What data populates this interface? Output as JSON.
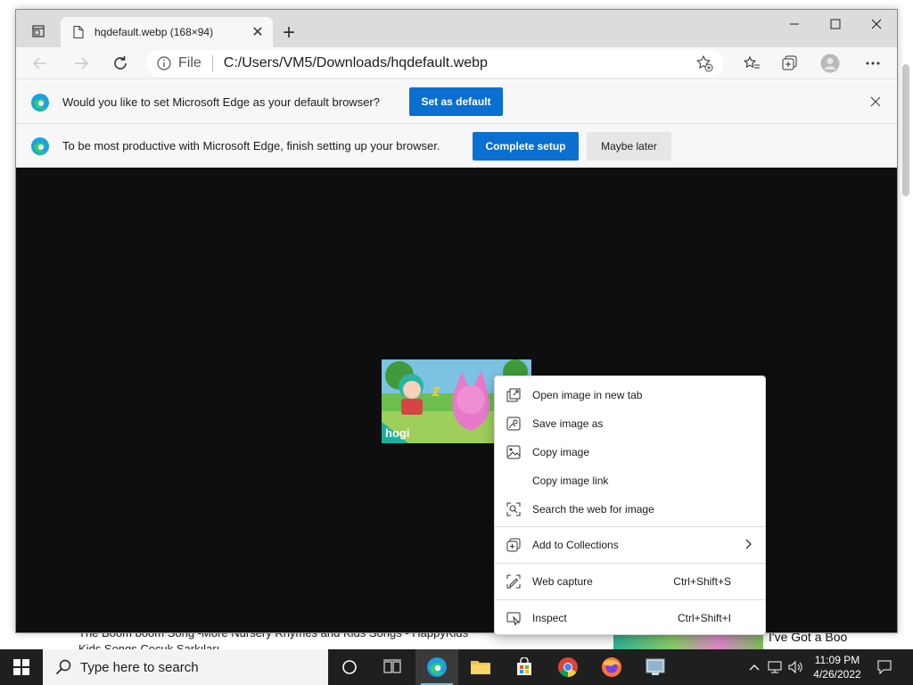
{
  "desktop": {
    "behind_text_1": "The Boom boom Song -More Nursery Rhymes and Kids Songs - HappyKids  ",
    "behind_text_2": "Kids Songs Çocuk Şarkıları",
    "behind_text_3": "I've Got a Boo"
  },
  "browser": {
    "tab": {
      "title": "hqdefault.webp (168×94)",
      "close_glyph": "✕"
    },
    "new_tab_glyph": "+",
    "address": {
      "scheme": "File",
      "url": "C:/Users/VM5/Downloads/hqdefault.webp"
    }
  },
  "infobar_default": {
    "message": "Would you like to set Microsoft Edge as your default browser?",
    "primary_label": "Set as default"
  },
  "infobar_setup": {
    "message": "To be most productive with Microsoft Edge, finish setting up your browser.",
    "primary_label": "Complete setup",
    "secondary_label": "Maybe later"
  },
  "image": {
    "logo_text": "hogi"
  },
  "context_menu": {
    "items": [
      {
        "label": "Open image in new tab",
        "icon": "open-in-new-tab-icon",
        "shortcut": ""
      },
      {
        "label": "Save image as",
        "icon": "save-icon",
        "shortcut": ""
      },
      {
        "label": "Copy image",
        "icon": "image-icon",
        "shortcut": ""
      },
      {
        "label": "Copy image link",
        "icon": "",
        "shortcut": ""
      },
      {
        "label": "Search the web for image",
        "icon": "visual-search-icon",
        "shortcut": ""
      },
      {
        "label": "Add to Collections",
        "icon": "collections-icon",
        "shortcut": ""
      },
      {
        "label": "Web capture",
        "icon": "web-capture-icon",
        "shortcut": "Ctrl+Shift+S"
      },
      {
        "label": "Inspect",
        "icon": "inspect-icon",
        "shortcut": "Ctrl+Shift+I"
      }
    ]
  },
  "taskbar": {
    "search_placeholder": "Type here to search",
    "time": "11:09 PM",
    "date": "4/26/2022"
  },
  "colors": {
    "accent": "#0a6fd0",
    "content_bg": "#0e0e0e",
    "taskbar_bg": "#1f1f1f"
  }
}
